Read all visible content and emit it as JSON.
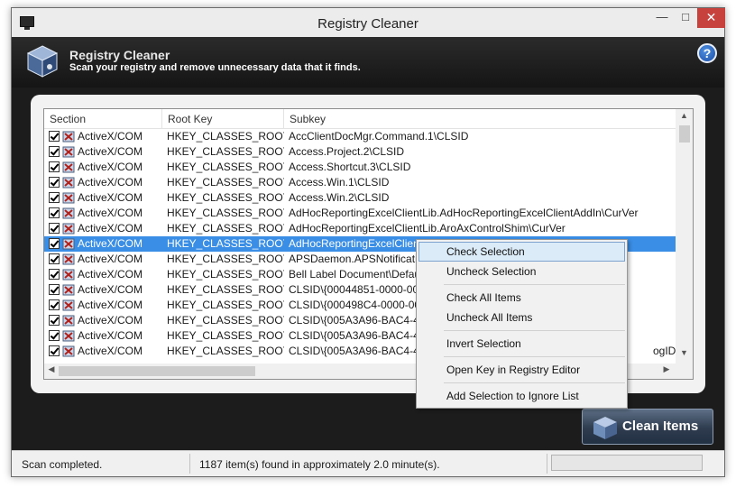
{
  "window": {
    "title": "Registry Cleaner",
    "close_glyph": "✕",
    "min_glyph": "—",
    "max_glyph": "□"
  },
  "header": {
    "title": "Registry Cleaner",
    "subtitle": "Scan your registry and remove unnecessary data that it finds.",
    "help_label": "?"
  },
  "table": {
    "columns": [
      "Section",
      "Root Key",
      "Subkey"
    ],
    "rows": [
      {
        "section": "ActiveX/COM",
        "root": "HKEY_CLASSES_ROOT",
        "subkey": "AccClientDocMgr.Command.1\\CLSID",
        "checked": true
      },
      {
        "section": "ActiveX/COM",
        "root": "HKEY_CLASSES_ROOT",
        "subkey": "Access.Project.2\\CLSID",
        "checked": true
      },
      {
        "section": "ActiveX/COM",
        "root": "HKEY_CLASSES_ROOT",
        "subkey": "Access.Shortcut.3\\CLSID",
        "checked": true
      },
      {
        "section": "ActiveX/COM",
        "root": "HKEY_CLASSES_ROOT",
        "subkey": "Access.Win.1\\CLSID",
        "checked": true
      },
      {
        "section": "ActiveX/COM",
        "root": "HKEY_CLASSES_ROOT",
        "subkey": "Access.Win.2\\CLSID",
        "checked": true
      },
      {
        "section": "ActiveX/COM",
        "root": "HKEY_CLASSES_ROOT",
        "subkey": "AdHocReportingExcelClientLib.AdHocReportingExcelClientAddIn\\CurVer",
        "checked": true
      },
      {
        "section": "ActiveX/COM",
        "root": "HKEY_CLASSES_ROOT",
        "subkey": "AdHocReportingExcelClientLib.AroAxControlShim\\CurVer",
        "checked": true
      },
      {
        "section": "ActiveX/COM",
        "root": "HKEY_CLASSES_ROOT",
        "subkey": "AdHocReportingExcelClientL",
        "checked": true,
        "selected": true
      },
      {
        "section": "ActiveX/COM",
        "root": "HKEY_CLASSES_ROOT",
        "subkey": "APSDaemon.APSNotification",
        "checked": true
      },
      {
        "section": "ActiveX/COM",
        "root": "HKEY_CLASSES_ROOT",
        "subkey": "Bell Label Document\\Default",
        "checked": true
      },
      {
        "section": "ActiveX/COM",
        "root": "HKEY_CLASSES_ROOT",
        "subkey": "CLSID\\{00044851-0000-000",
        "checked": true
      },
      {
        "section": "ActiveX/COM",
        "root": "HKEY_CLASSES_ROOT",
        "subkey": "CLSID\\{000498C4-0000-000",
        "checked": true
      },
      {
        "section": "ActiveX/COM",
        "root": "HKEY_CLASSES_ROOT",
        "subkey": "CLSID\\{005A3A96-BAC4-4B",
        "checked": true
      },
      {
        "section": "ActiveX/COM",
        "root": "HKEY_CLASSES_ROOT",
        "subkey": "CLSID\\{005A3A96-BAC4-4B",
        "checked": true
      },
      {
        "section": "ActiveX/COM",
        "root": "HKEY_CLASSES_ROOT",
        "subkey": "CLSID\\{005A3A96-BAC4-4B",
        "trailing": "ogID",
        "checked": true
      }
    ]
  },
  "context_menu": {
    "items": [
      "Check Selection",
      "Uncheck Selection",
      "Check All Items",
      "Uncheck All Items",
      "Invert Selection",
      "Open Key in Registry Editor",
      "Add Selection to Ignore List"
    ],
    "highlighted": "Check Selection"
  },
  "clean_button": {
    "label": "Clean Items"
  },
  "status": {
    "left": "Scan completed.",
    "middle": "1187 item(s) found in approximately 2.0 minute(s)."
  },
  "colors": {
    "selection": "#3a8ee6",
    "header_bg": "#1c1c1c",
    "close": "#c7413d"
  }
}
